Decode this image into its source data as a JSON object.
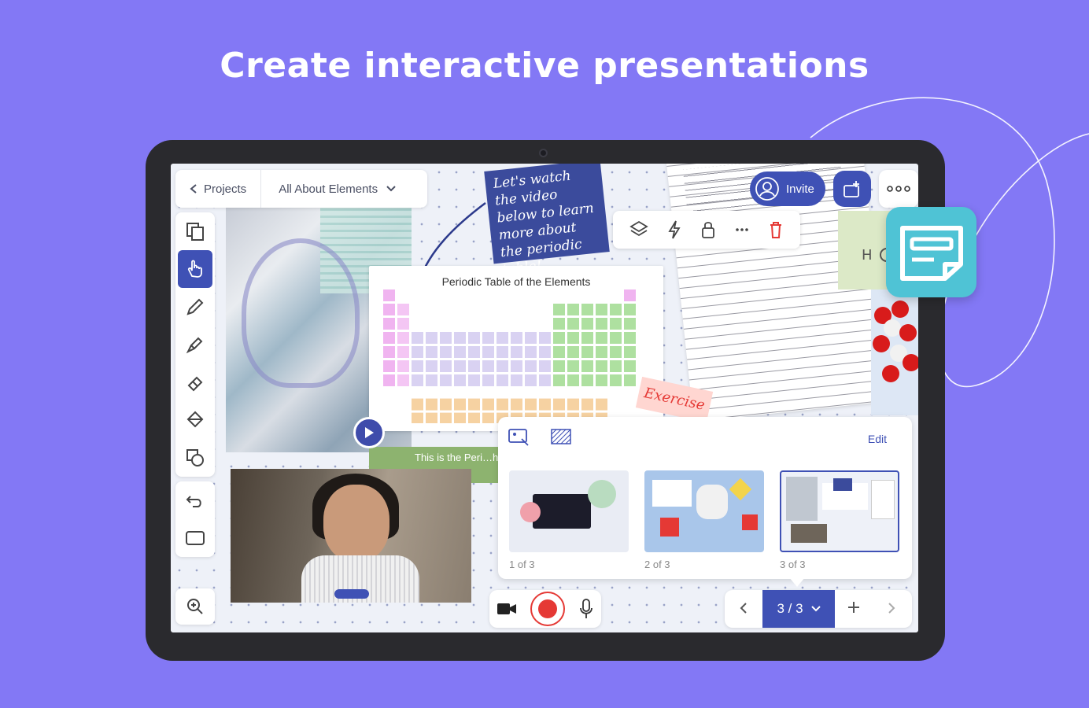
{
  "headline": "Create interactive presentations",
  "topbar": {
    "back_label": "Projects",
    "project_name": "All About Elements"
  },
  "canvas": {
    "sticky_note": "Let's watch the video below to learn more about the periodic table!",
    "periodic_title": "Periodic Table of the Elements",
    "caption": "This is the Peri…hat o…",
    "exercise_label": "Exercise"
  },
  "header_actions": {
    "invite_label": "Invite"
  },
  "slides_panel": {
    "edit_label": "Edit",
    "slides": [
      {
        "label": "1 of 3"
      },
      {
        "label": "2 of 3"
      },
      {
        "label": "3 of 3"
      }
    ]
  },
  "pager": {
    "current": "3 / 3"
  },
  "colors": {
    "background": "#8378f5",
    "accent": "#3f51b5",
    "record": "#e53935",
    "card": "#4fc3d5"
  },
  "icons": [
    "chevron-left-icon",
    "chevron-down-icon",
    "copy-icon",
    "hand-icon",
    "pen-icon",
    "marker-icon",
    "eraser-icon",
    "fill-icon",
    "shapes-icon",
    "undo-icon",
    "frame-icon",
    "zoom-icon",
    "layers-icon",
    "bolt-icon",
    "lock-icon",
    "more-icon",
    "trash-icon",
    "share-icon",
    "person-icon",
    "camera-icon",
    "record-icon",
    "mic-icon",
    "plus-icon",
    "chevron-right-icon",
    "sticky-note-icon"
  ]
}
